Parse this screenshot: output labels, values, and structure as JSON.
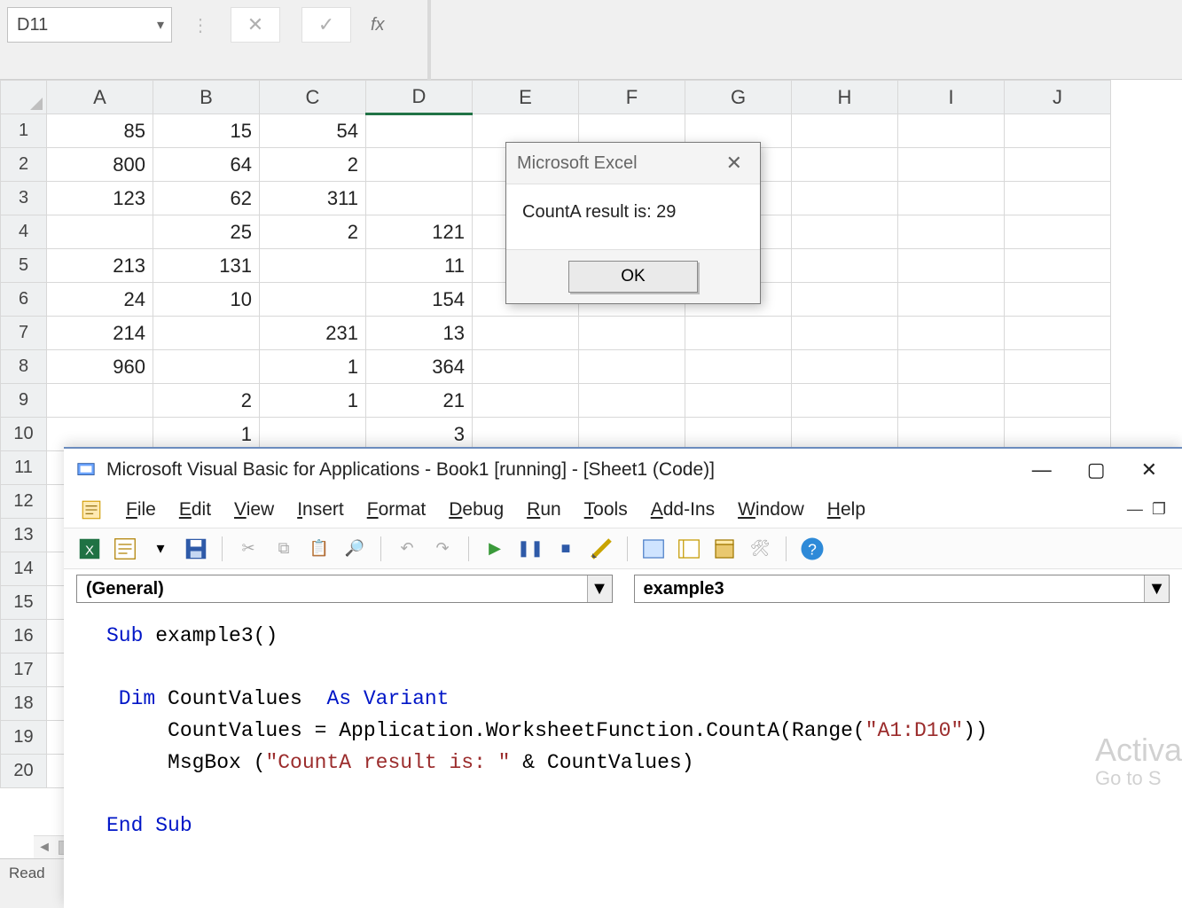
{
  "excel": {
    "name_box": "D11",
    "fx_label": "fx",
    "status": "Read",
    "columns": [
      "A",
      "B",
      "C",
      "D",
      "E",
      "F",
      "G",
      "H",
      "I",
      "J"
    ],
    "row_count": 20,
    "selected_col_idx": 3,
    "selected_row_idx": 10,
    "cells": {
      "0": {
        "0": "85",
        "1": "15",
        "2": "54"
      },
      "1": {
        "0": "800",
        "1": "64",
        "2": "2"
      },
      "2": {
        "0": "123",
        "1": "62",
        "2": "311"
      },
      "3": {
        "1": "25",
        "2": "2",
        "3": "121"
      },
      "4": {
        "0": "213",
        "1": "131",
        "3": "11"
      },
      "5": {
        "0": "24",
        "1": "10",
        "3": "154"
      },
      "6": {
        "0": "214",
        "2": "231",
        "3": "13"
      },
      "7": {
        "0": "960",
        "2": "1",
        "3": "364"
      },
      "8": {
        "1": "2",
        "2": "1",
        "3": "21"
      },
      "9": {
        "1": "1",
        "3": "3"
      }
    }
  },
  "msgbox": {
    "title": "Microsoft Excel",
    "message": "CountA result is: 29",
    "ok": "OK"
  },
  "vbe": {
    "title": "Microsoft Visual Basic for Applications - Book1 [running] - [Sheet1 (Code)]",
    "menus": [
      "File",
      "Edit",
      "View",
      "Insert",
      "Format",
      "Debug",
      "Run",
      "Tools",
      "Add-Ins",
      "Window",
      "Help"
    ],
    "object_dd": "(General)",
    "proc_dd": "example3",
    "code": {
      "l1a": "Sub",
      "l1b": " example3()",
      "l3a": " Dim",
      "l3b": " CountValues  ",
      "l3c": "As Variant",
      "l4": "     CountValues = Application.WorksheetFunction.CountA(Range(",
      "l4s": "\"A1:D10\"",
      "l4e": "))",
      "l5a": "     MsgBox (",
      "l5s": "\"CountA result is: \"",
      "l5b": " & CountValues)",
      "l7": "End Sub"
    }
  },
  "watermark": {
    "big": "Activa",
    "small": "Go to S"
  }
}
